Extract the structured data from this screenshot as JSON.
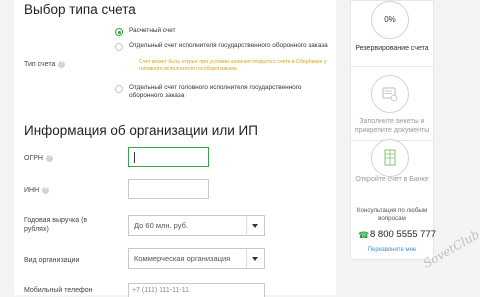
{
  "sections": {
    "account_type_title": "Выбор типа счета",
    "org_info_title": "Информация об организации или ИП"
  },
  "account_type": {
    "label": "Тип счета",
    "options": [
      "Расчетный счет",
      "Отдельный счет исполнителя государственного оборонного заказа",
      "Отдельный счет головного исполнителя государственного оборонного заказа"
    ],
    "selected_index": 0,
    "note": "Счет может быть открыт при условии наличия открытого счета в Сбербанке у головного исполнителя гособоронзаказа"
  },
  "fields": {
    "ogrn_label": "ОГРН",
    "inn_label": "ИНН",
    "revenue_label": "Годовая выручка (в рублях)",
    "revenue_value": "До 60 млн. руб.",
    "org_type_label": "Вид организации",
    "org_type_value": "Коммерческая организация",
    "phone_label": "Мобильный телефон",
    "phone_placeholder": "+7 (111) 111-11-11"
  },
  "help_icon_glyph": "?",
  "sidebar": {
    "progress_percent": "0%",
    "steps": [
      {
        "label": "Резервирование счета",
        "icon": "percent-circle",
        "state": "active"
      },
      {
        "label": "Заполните анкеты и прикрепите документы",
        "icon": "document-icon",
        "state": "inactive"
      },
      {
        "label": "Откройте счет в Банке",
        "icon": "bank-icon",
        "state": "inactive"
      }
    ],
    "consultation": "Консультация по любым вопросам",
    "phone": "8 800 5555 777",
    "callback": "Перезвоните мне"
  },
  "watermark": "SovetClub",
  "colors": {
    "accent": "#2f9e44",
    "note": "#d9a318",
    "link": "#3c8fd6"
  }
}
